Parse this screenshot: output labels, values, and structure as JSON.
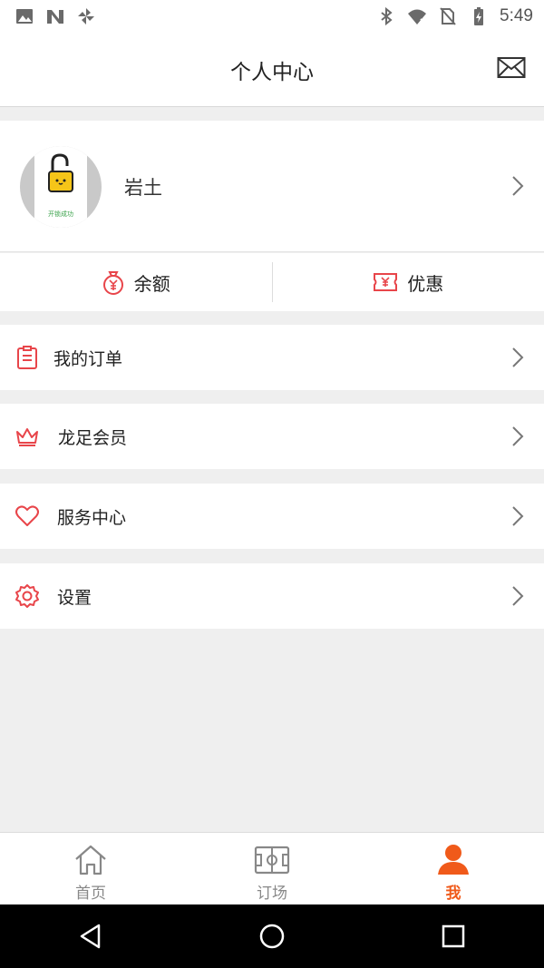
{
  "status_bar": {
    "time": "5:49",
    "left_icons": [
      "image-icon",
      "n-logo-icon",
      "pinwheel-icon"
    ],
    "right_icons": [
      "bluetooth-icon",
      "wifi-icon",
      "no-sim-icon",
      "battery-charging-icon"
    ]
  },
  "header": {
    "title": "个人中心",
    "right_icon": "mail-icon"
  },
  "profile": {
    "username": "岩土",
    "avatar_caption": "开锁成功"
  },
  "quick_actions": [
    {
      "label": "余额",
      "icon": "money-bag-icon"
    },
    {
      "label": "优惠",
      "icon": "coupon-icon"
    }
  ],
  "menu": [
    {
      "label": "我的订单",
      "icon": "clipboard-icon"
    },
    {
      "label": "龙足会员",
      "icon": "crown-icon"
    },
    {
      "label": "服务中心",
      "icon": "heart-icon"
    },
    {
      "label": "设置",
      "icon": "gear-icon"
    }
  ],
  "bottom_nav": [
    {
      "label": "首页",
      "icon": "home-icon",
      "active": false
    },
    {
      "label": "订场",
      "icon": "field-icon",
      "active": false
    },
    {
      "label": "我",
      "icon": "person-icon",
      "active": true
    }
  ],
  "colors": {
    "accent": "#f05a1a",
    "icon_red": "#e8454a",
    "page_background": "#efefef"
  }
}
